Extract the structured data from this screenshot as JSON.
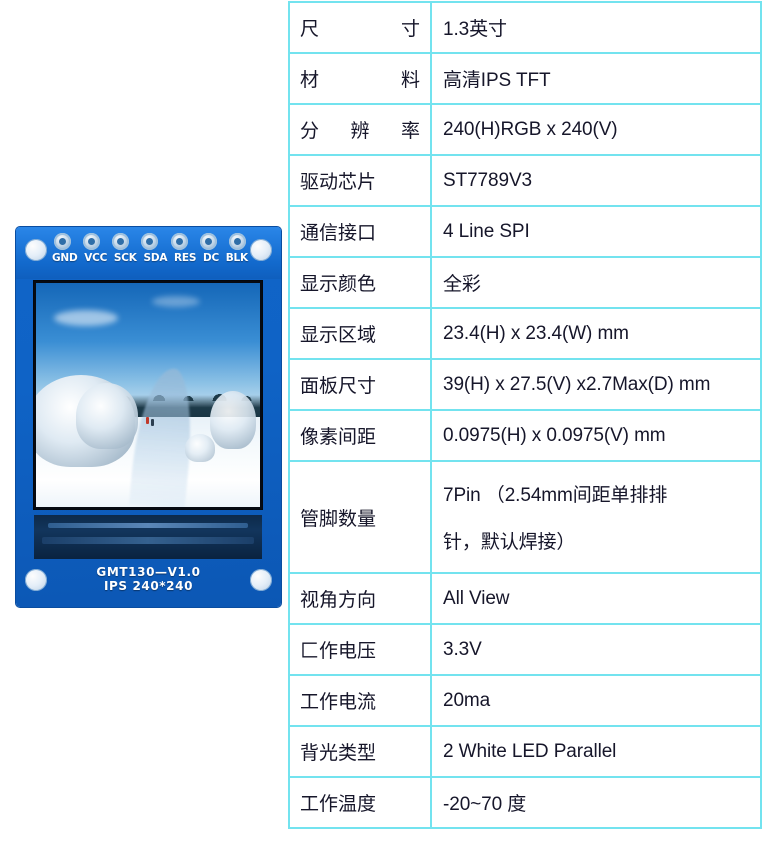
{
  "accent": {
    "color": "#ec4a0a",
    "name": "tab-indicator"
  },
  "product_photo": {
    "name": "lcd-module-photo",
    "pins": [
      "GND",
      "VCC",
      "SCK",
      "SDA",
      "RES",
      "DC",
      "BLK"
    ],
    "silkscreen_line1": "GMT130—V1.0",
    "silkscreen_line2": "IPS 240*240",
    "screen_content": "winter snow landscape photo"
  },
  "spec_table": {
    "border_color": "#73e3ef",
    "text_color": "#16162a",
    "rows": [
      {
        "key": "尺寸",
        "spaced": true,
        "value": "1.3英寸"
      },
      {
        "key": "材料",
        "spaced": true,
        "value": "高清IPS TFT"
      },
      {
        "key": "分辨率",
        "spaced": true,
        "value": "240(H)RGB x 240(V)"
      },
      {
        "key": "驱动芯片",
        "spaced": false,
        "value": "ST7789V3"
      },
      {
        "key": "通信接口",
        "spaced": false,
        "value": "4 Line SPI"
      },
      {
        "key": "显示颜色",
        "spaced": false,
        "value": "全彩"
      },
      {
        "key": "显示区域",
        "spaced": false,
        "value": "23.4(H) x 23.4(W) mm"
      },
      {
        "key": "面板尺寸",
        "spaced": false,
        "value": "39(H) x 27.5(V) x2.7Max(D) mm"
      },
      {
        "key": "像素间距",
        "spaced": false,
        "value": "0.0975(H) x 0.0975(V) mm"
      },
      {
        "key": "管脚数量",
        "spaced": false,
        "tall": true,
        "value_line1": "7Pin （2.54mm间距单排排",
        "value_line2": "针，默认焊接）"
      },
      {
        "key": "视角方向",
        "spaced": false,
        "value": "All View"
      },
      {
        "key": "匚作电压",
        "spaced": false,
        "value": "3.3V"
      },
      {
        "key": "工作电流",
        "spaced": false,
        "value": "20ma"
      },
      {
        "key": "背光类型",
        "spaced": false,
        "value": "2 White LED Parallel"
      },
      {
        "key": "工作温度",
        "spaced": false,
        "value": "-20~70 度"
      }
    ]
  }
}
